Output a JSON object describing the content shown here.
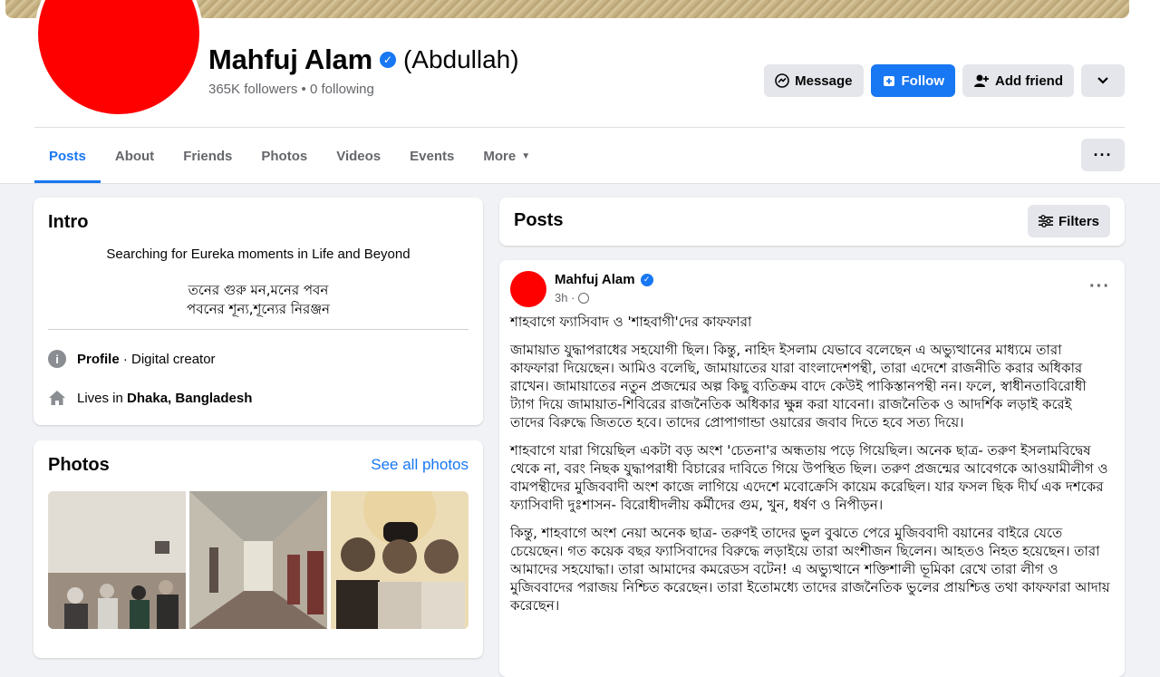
{
  "profile": {
    "name": "Mahfuj Alam",
    "alt_name": "(Abdullah)",
    "followers": "365K followers • 0 following",
    "verified_icon": "check"
  },
  "actions": {
    "message": "Message",
    "follow": "Follow",
    "add_friend": "Add friend"
  },
  "tabs": [
    "Posts",
    "About",
    "Friends",
    "Photos",
    "Videos",
    "Events",
    "More"
  ],
  "intro": {
    "title": "Intro",
    "bio": "Searching for Eureka moments in Life and Beyond",
    "bio_bn_line1": "তনের গুরু মন,মনের পবন",
    "bio_bn_line2": "পবনের শূন্য,শূন্যের নিরঞ্জন",
    "profile_label": "Profile",
    "profile_category": " · Digital creator",
    "lives_in_prefix": "Lives in ",
    "lives_in_place": "Dhaka, Bangladesh"
  },
  "photos": {
    "title": "Photos",
    "see_all": "See all photos"
  },
  "posts_header": {
    "title": "Posts",
    "filters": "Filters"
  },
  "post": {
    "author": "Mahfuj Alam",
    "time": "3h ·",
    "title": "শাহবাগে ফ্যাসিবাদ ও 'শাহবাগী'দের কাফফারা",
    "p1": "জামায়াত যুদ্ধাপরাধের সহযোগী ছিল। কিন্তু, নাহিদ ইসলাম যেভাবে বলেছেন এ অভ্যুত্থানের মাধ্যমে তারা কাফফারা দিয়েছেন। আমিও বলেছি, জামায়াতের যারা বাংলাদেশপন্থী, তারা এদেশে রাজনীতি করার অধিকার রাখেন। জামায়াতের নতুন প্রজন্মের অল্প কিছু ব্যতিক্রম বাদে কেউই পাকিস্তানপন্থী নন। ফলে, স্বাধীনতাবিরোধী ট্যাগ দিয়ে জামায়াত-শিবিরের রাজনৈতিক অধিকার ক্ষুন্ন করা যাবেনা। রাজনৈতিক ও আদর্শিক লড়াই করেই তাদের বিরুদ্ধে জিততে হবে। তাদের প্রোপাগান্ডা ওয়ারের জবাব দিতে হবে সত্য দিয়ে।",
    "p2": "শাহবাগে যারা গিয়েছিল একটা বড় অংশ 'চেতনা'র অন্ধতায় পড়ে গিয়েছিল। অনেক ছাত্র- তরুণ ইসলামবিদ্বেষ থেকে না, বরং নিছক যুদ্ধাপরাধী বিচারের দাবিতে গিয়ে উপস্থিত ছিল। তরুণ প্রজন্মের আবেগকে আওয়ামীলীগ ও বামপন্থীদের মুজিববাদী অংশ কাজে লাগিয়ে এদেশে মবোক্রেসি কায়েম করেছিল। যার ফসল ছিক দীর্ঘ এক দশকের ফ্যাসিবাদী দুঃশাসন- বিরোধীদলীয় কর্মীদের গুম, খুন, ধর্ষণ ও নিপীড়ন।",
    "p3": "কিন্তু, শাহবাগে অংশ নেয়া অনেক ছাত্র- তরুণই তাদের ভুল বুঝতে পেরে মুজিববাদী বয়ানের বাইরে যেতে চেয়েছেন। গত কয়েক বছর ফ্যাসিবাদের বিরুদ্ধে লড়াইয়ে তারা অংশীজন ছিলেন। আহতও নিহত হয়েছেন। তারা আমাদের সহযোদ্ধা। তারা আমাদের কমরেডস বটেন! এ অভ্যুত্থানে শক্তিশালী ভূমিকা রেখে তারা লীগ ও মুজিববাদের পরাজয় নিশ্চিত করেছেন। তারা ইতোমধ্যে তাদের রাজনৈতিক ভুলের প্রায়শ্চিত্ত তথা কাফফারা আদায় করেছেন।"
  },
  "colors": {
    "accent": "#1877f2",
    "avatar": "#ff0000",
    "background": "#f0f2f5"
  }
}
